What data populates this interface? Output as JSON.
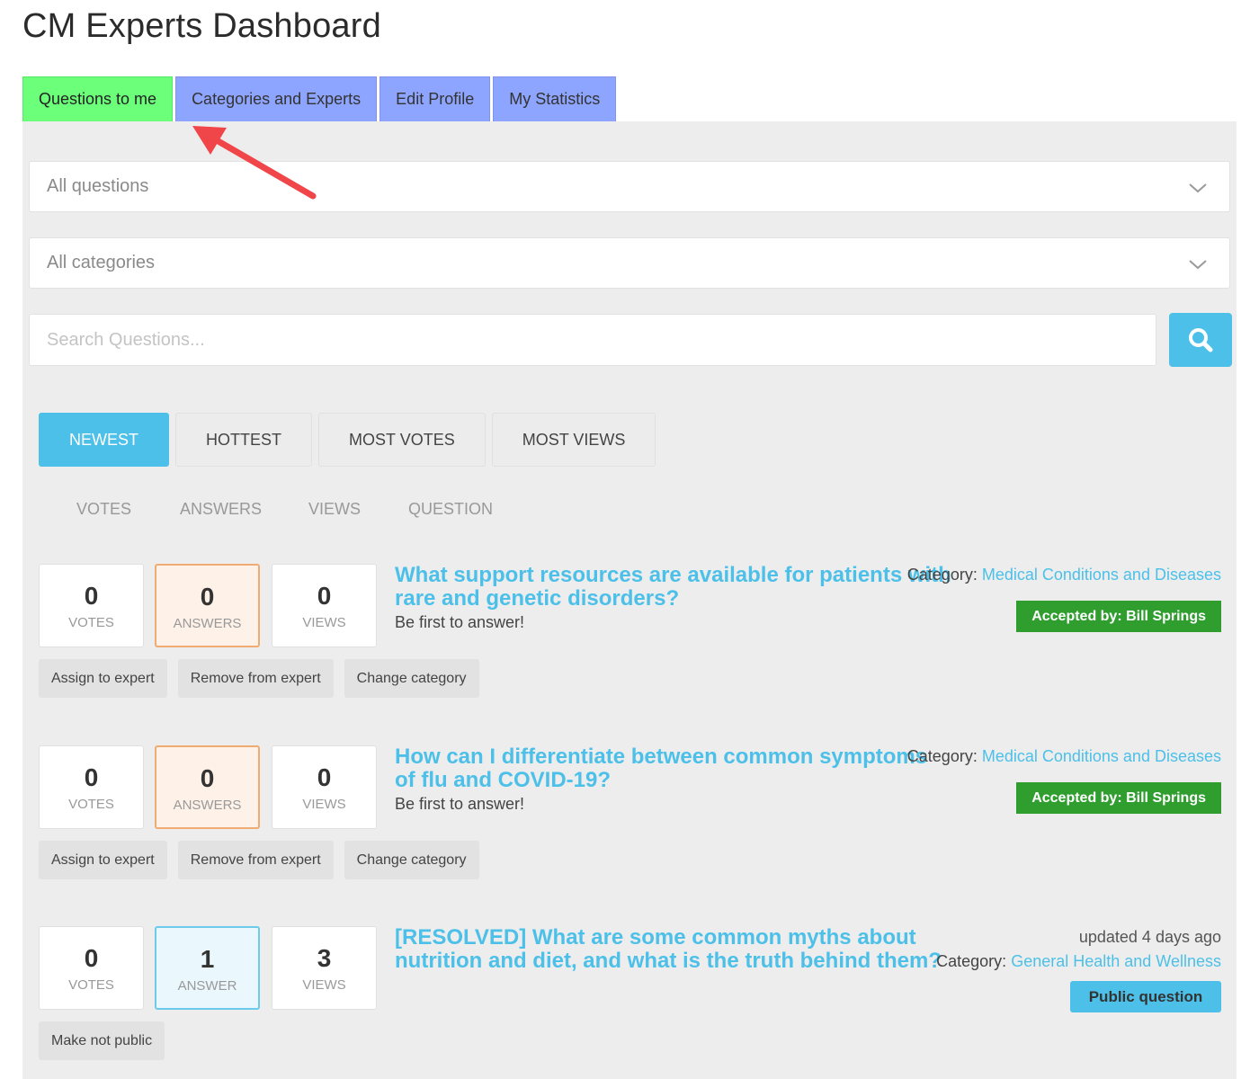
{
  "page": {
    "title": "CM Experts Dashboard"
  },
  "tabs": [
    {
      "label": "Questions to me",
      "active": true
    },
    {
      "label": "Categories and Experts",
      "active": false
    },
    {
      "label": "Edit Profile",
      "active": false
    },
    {
      "label": "My Statistics",
      "active": false
    }
  ],
  "filters": {
    "questions_select": "All questions",
    "categories_select": "All categories",
    "search_placeholder": "Search Questions..."
  },
  "sort_tabs": [
    {
      "label": "Newest",
      "active": true
    },
    {
      "label": "Hottest",
      "active": false
    },
    {
      "label": "Most votes",
      "active": false
    },
    {
      "label": "Most views",
      "active": false
    }
  ],
  "columns": [
    "Votes",
    "Answers",
    "Views",
    "Question"
  ],
  "questions": [
    {
      "votes": "0",
      "votes_label": "VOTES",
      "answers": "0",
      "answers_label": "ANSWERS",
      "views": "0",
      "views_label": "VIEWS",
      "title": "What support resources are available for patients with rare and genetic disorders?",
      "subtitle": "Be first to answer!",
      "category_label": "Category:",
      "category": "Medical Conditions and Diseases",
      "badge": "Accepted by: Bill Springs",
      "actions": [
        "Assign to expert",
        "Remove from expert",
        "Change category"
      ]
    },
    {
      "votes": "0",
      "votes_label": "VOTES",
      "answers": "0",
      "answers_label": "ANSWERS",
      "views": "0",
      "views_label": "VIEWS",
      "title": "How can I differentiate between common symptoms of flu and COVID-19?",
      "subtitle": "Be first to answer!",
      "category_label": "Category:",
      "category": "Medical Conditions and Diseases",
      "badge": "Accepted by: Bill Springs",
      "actions": [
        "Assign to expert",
        "Remove from expert",
        "Change category"
      ]
    },
    {
      "votes": "0",
      "votes_label": "VOTES",
      "answers": "1",
      "answers_label": "ANSWER",
      "views": "3",
      "views_label": "VIEWS",
      "title": "[RESOLVED] What are some common myths about nutrition and diet, and what is the truth behind them?",
      "updated": "updated 4 days ago",
      "category_label": "Category:",
      "category": "General Health and Wellness",
      "badge": "Public question",
      "actions": [
        "Make not public"
      ]
    }
  ],
  "colors": {
    "active_tab": "#6bff7a",
    "inactive_tab": "#8ea5ff",
    "accent": "#4cc0e8",
    "accepted_badge": "#2f9e2f",
    "annotation_arrow": "#f0464a"
  }
}
